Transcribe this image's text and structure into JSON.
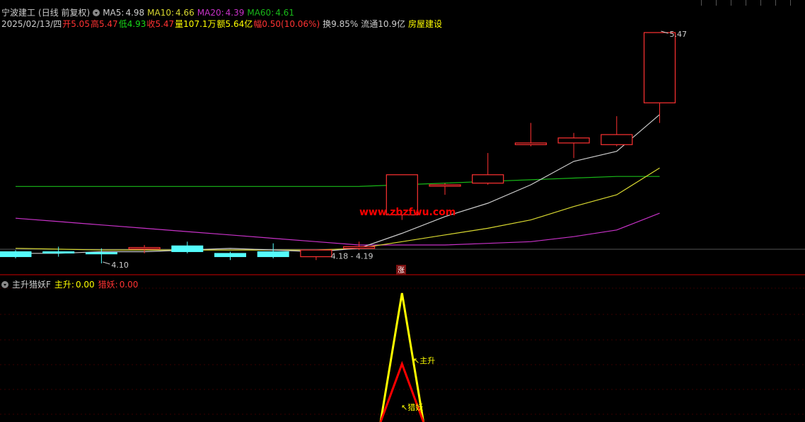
{
  "stock": {
    "name": "宁波建工",
    "mode": "(日线 前复权)",
    "date": "2025/02/13/四",
    "open_label": "开",
    "open": "5.05",
    "high_label": "高",
    "high": "5.47",
    "low_label": "低",
    "low": "4.93",
    "close_label": "收",
    "close": "5.47",
    "vol_label": "量",
    "vol": "107.1万",
    "amount_label": "额",
    "amount": "5.64亿",
    "change_label": "幅",
    "change": "0.50(10.06%)",
    "turnover_label": "换",
    "turnover": "9.85%",
    "float_label": "流通",
    "float": "10.9亿",
    "sector": "房屋建设"
  },
  "ma": {
    "ma5_label": "MA5:",
    "ma5": "4.98",
    "ma10_label": "MA10:",
    "ma10": "4.66",
    "ma20_label": "MA20:",
    "ma20": "4.39",
    "ma60_label": "MA60:",
    "ma60": "4.61"
  },
  "indicator": {
    "name": "主升猎妖F",
    "zs_label": "主升:",
    "zs_value": "0.00",
    "ly_label": "猎妖:",
    "ly_value": "0.00",
    "zs_tag": "主升",
    "ly_tag": "猎妖"
  },
  "watermark": "www.zbzfwu.com",
  "zhang_badge": "涨",
  "colors": {
    "up": "#ff3232",
    "down": "#54fcfc",
    "ma5": "#cccccc",
    "ma10": "#d8d830",
    "ma20": "#c832c8",
    "ma60": "#18b818",
    "zs": "#ffff00",
    "ly": "#ff0000"
  },
  "chart_data": [
    {
      "type": "candlestick",
      "candles": [
        {
          "o": 4.16,
          "h": 4.17,
          "l": 4.12,
          "c": 4.13
        },
        {
          "o": 4.16,
          "h": 4.19,
          "l": 4.13,
          "c": 4.155
        },
        {
          "o": 4.155,
          "h": 4.18,
          "l": 4.09,
          "c": 4.15
        },
        {
          "o": 4.18,
          "h": 4.2,
          "l": 4.15,
          "c": 4.185
        },
        {
          "o": 4.195,
          "h": 4.22,
          "l": 4.15,
          "c": 4.16
        },
        {
          "o": 4.15,
          "h": 4.16,
          "l": 4.11,
          "c": 4.13
        },
        {
          "o": 4.16,
          "h": 4.21,
          "l": 4.12,
          "c": 4.13
        },
        {
          "o": 4.13,
          "h": 4.17,
          "l": 4.11,
          "c": 4.17
        },
        {
          "o": 4.18,
          "h": 4.22,
          "l": 4.17,
          "c": 4.19
        },
        {
          "o": 4.38,
          "h": 4.62,
          "l": 4.35,
          "c": 4.62
        },
        {
          "o": 4.56,
          "h": 4.57,
          "l": 4.5,
          "c": 4.56
        },
        {
          "o": 4.57,
          "h": 4.75,
          "l": 4.56,
          "c": 4.62
        },
        {
          "o": 4.8,
          "h": 4.93,
          "l": 4.79,
          "c": 4.81
        },
        {
          "o": 4.81,
          "h": 4.87,
          "l": 4.72,
          "c": 4.84
        },
        {
          "o": 4.8,
          "h": 4.97,
          "l": 4.79,
          "c": 4.86
        },
        {
          "o": 5.05,
          "h": 5.47,
          "l": 4.93,
          "c": 5.47
        }
      ],
      "ma5": [
        4.15,
        4.15,
        4.16,
        4.16,
        4.17,
        4.18,
        4.17,
        4.16,
        4.18,
        4.27,
        4.37,
        4.45,
        4.56,
        4.7,
        4.76,
        4.98
      ],
      "ma10": [
        4.18,
        4.175,
        4.17,
        4.17,
        4.17,
        4.17,
        4.17,
        4.17,
        4.18,
        4.22,
        4.26,
        4.3,
        4.35,
        4.43,
        4.5,
        4.66
      ],
      "ma20": [
        4.36,
        4.34,
        4.32,
        4.3,
        4.28,
        4.26,
        4.24,
        4.22,
        4.2,
        4.2,
        4.2,
        4.21,
        4.22,
        4.25,
        4.29,
        4.39
      ],
      "ma60": [
        4.55,
        4.55,
        4.55,
        4.55,
        4.55,
        4.55,
        4.55,
        4.55,
        4.55,
        4.56,
        4.57,
        4.58,
        4.59,
        4.6,
        4.61,
        4.61
      ],
      "annotations": [
        {
          "text": "4.10",
          "index": 2,
          "price": 4.09
        },
        {
          "text": "4.18 - 4.19",
          "index": 8,
          "price": 4.16
        },
        {
          "text": "5.47",
          "index": 15,
          "price": 5.47
        }
      ]
    },
    {
      "type": "line",
      "series": [
        {
          "name": "主升",
          "x": [
            8.5,
            9.0,
            9.5
          ],
          "values": [
            0.0,
            1.0,
            0.0
          ]
        },
        {
          "name": "猎妖",
          "x": [
            8.5,
            9.0,
            9.5
          ],
          "values": [
            0.0,
            0.5,
            0.0
          ]
        }
      ]
    }
  ]
}
